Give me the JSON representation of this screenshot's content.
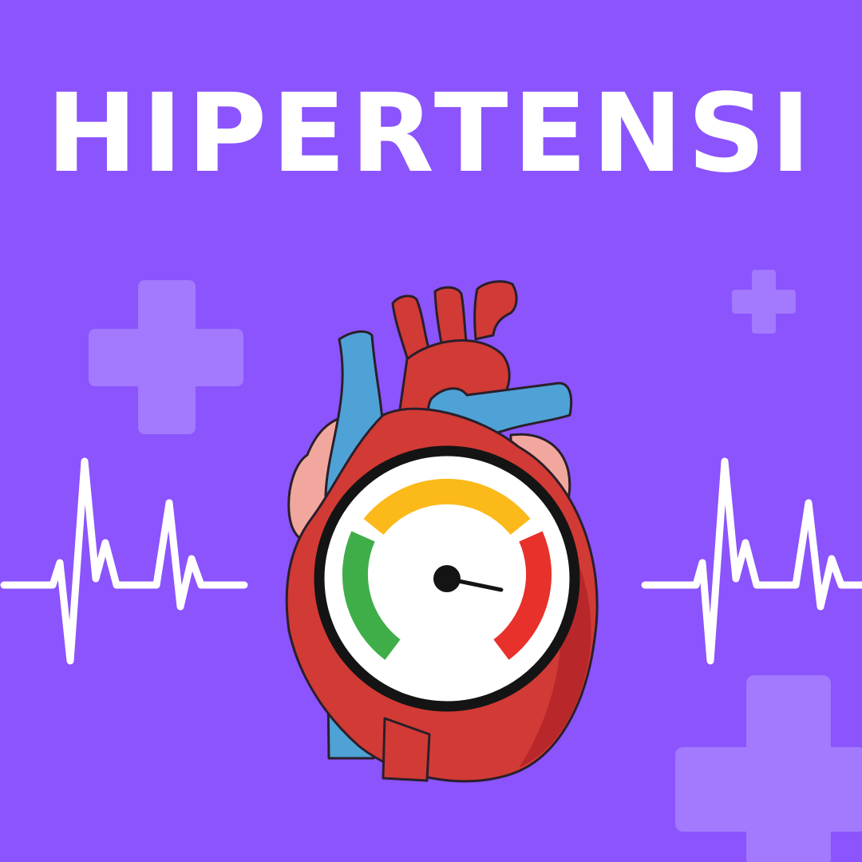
{
  "title": "HIPERTENSI",
  "colors": {
    "background": "#8b54fd",
    "plus": "#a379fd",
    "pulse": "#ffffff",
    "title": "#ffffff",
    "heart_red": "#d23a35",
    "heart_dark_red": "#b8282a",
    "heart_pink": "#f2a79e",
    "vessel_blue": "#4ea2d6",
    "gauge_green": "#3fae49",
    "gauge_yellow": "#fbb91a",
    "gauge_red": "#e8312a"
  },
  "icons": [
    "plus-icon",
    "heart-icon",
    "pressure-gauge-icon",
    "heartbeat-line-icon"
  ],
  "gauge_reading": {
    "zone": "red",
    "needle_angle_deg": 10
  }
}
